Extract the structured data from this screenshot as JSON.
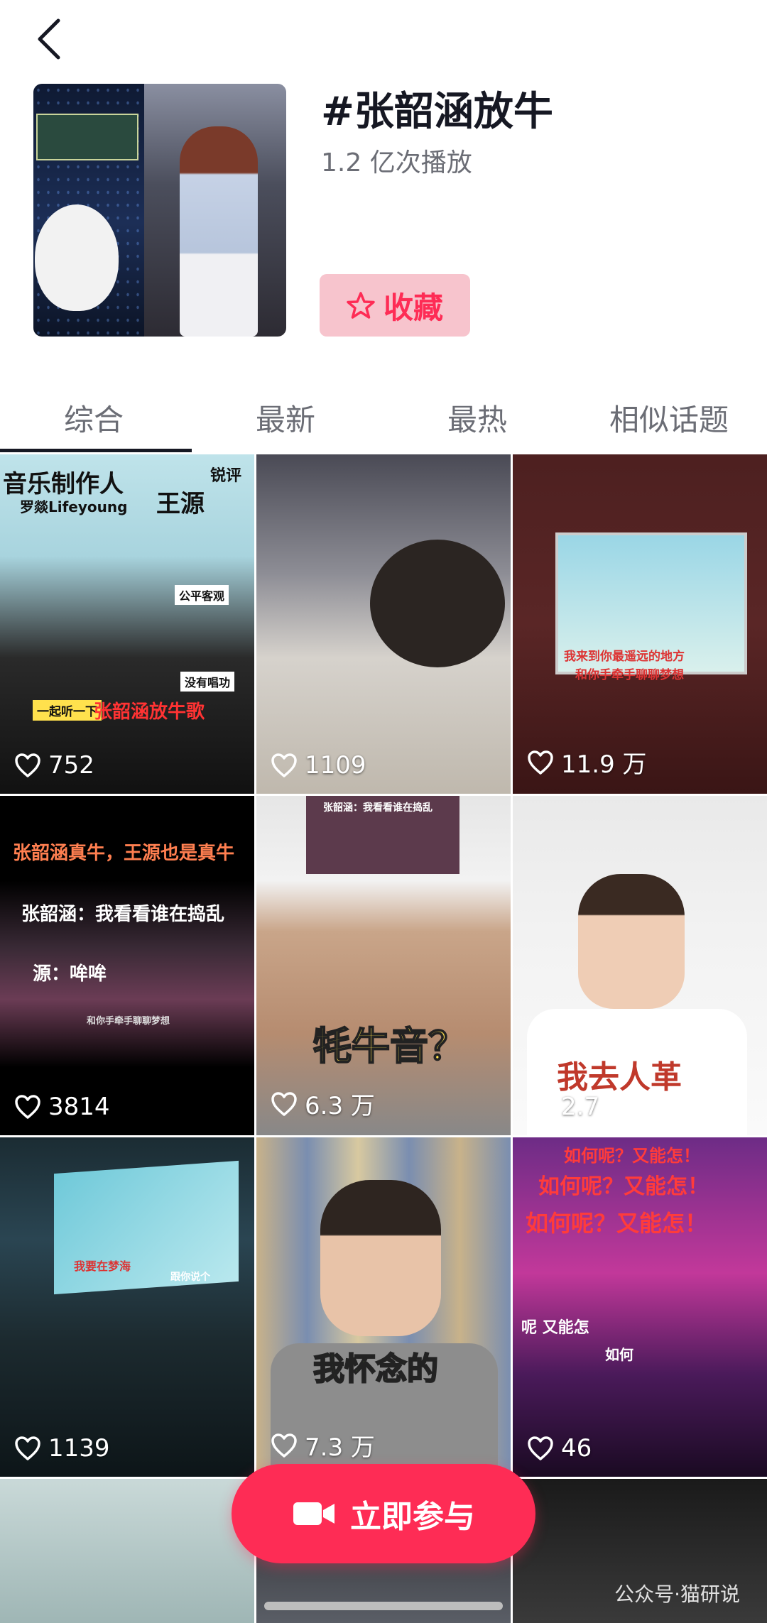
{
  "header": {
    "title": "#张韶涵放牛",
    "play_count": "1.2 亿次播放",
    "favorite_label": "收藏"
  },
  "tabs": [
    {
      "label": "综合",
      "active": true
    },
    {
      "label": "最新",
      "active": false
    },
    {
      "label": "最热",
      "active": false
    },
    {
      "label": "相似话题",
      "active": false
    }
  ],
  "videos": [
    {
      "likes": "752",
      "overlay": [
        "音乐制作人",
        "锐评",
        "罗燚Lifeyoung",
        "王源",
        "公平客观",
        "没有唱功",
        "一起听一下",
        "张韶涵放牛歌"
      ]
    },
    {
      "likes": "1109",
      "overlay": []
    },
    {
      "likes": "11.9 万",
      "overlay": [
        "我来到你最遥远的地方",
        "和你手牵手聊聊梦想"
      ]
    },
    {
      "likes": "3814",
      "overlay": [
        "张韶涵真牛，王源也是真牛",
        "张韶涵：我看看谁在捣乱",
        "源：哞哞",
        "和你手牵手聊聊梦想"
      ]
    },
    {
      "likes": "6.3 万",
      "overlay": [
        "张韶涵：我看看谁在捣乱",
        "牦牛音？"
      ]
    },
    {
      "likes": "2.7",
      "overlay": [
        "我去人革"
      ]
    },
    {
      "likes": "1139",
      "overlay": [
        "我要在梦海",
        "跟你说个"
      ]
    },
    {
      "likes": "7.3 万",
      "overlay": [
        "我怀念的"
      ]
    },
    {
      "likes": "46",
      "overlay": [
        "如何呢？又能怎！",
        "如何呢？又能怎！",
        "如何呢？又能怎！",
        "呢 又能怎",
        "如何"
      ]
    }
  ],
  "join_button_label": "立即参与",
  "watermark": "公众号·猫研说",
  "colors": {
    "accent": "#fe2c55",
    "favorite_bg": "#f7c4cd",
    "text_primary": "#161823",
    "text_secondary": "#6b6d75"
  },
  "icons": {
    "back": "chevron-left-icon",
    "favorite": "star-outline-icon",
    "like": "heart-outline-icon",
    "join": "video-camera-icon"
  }
}
